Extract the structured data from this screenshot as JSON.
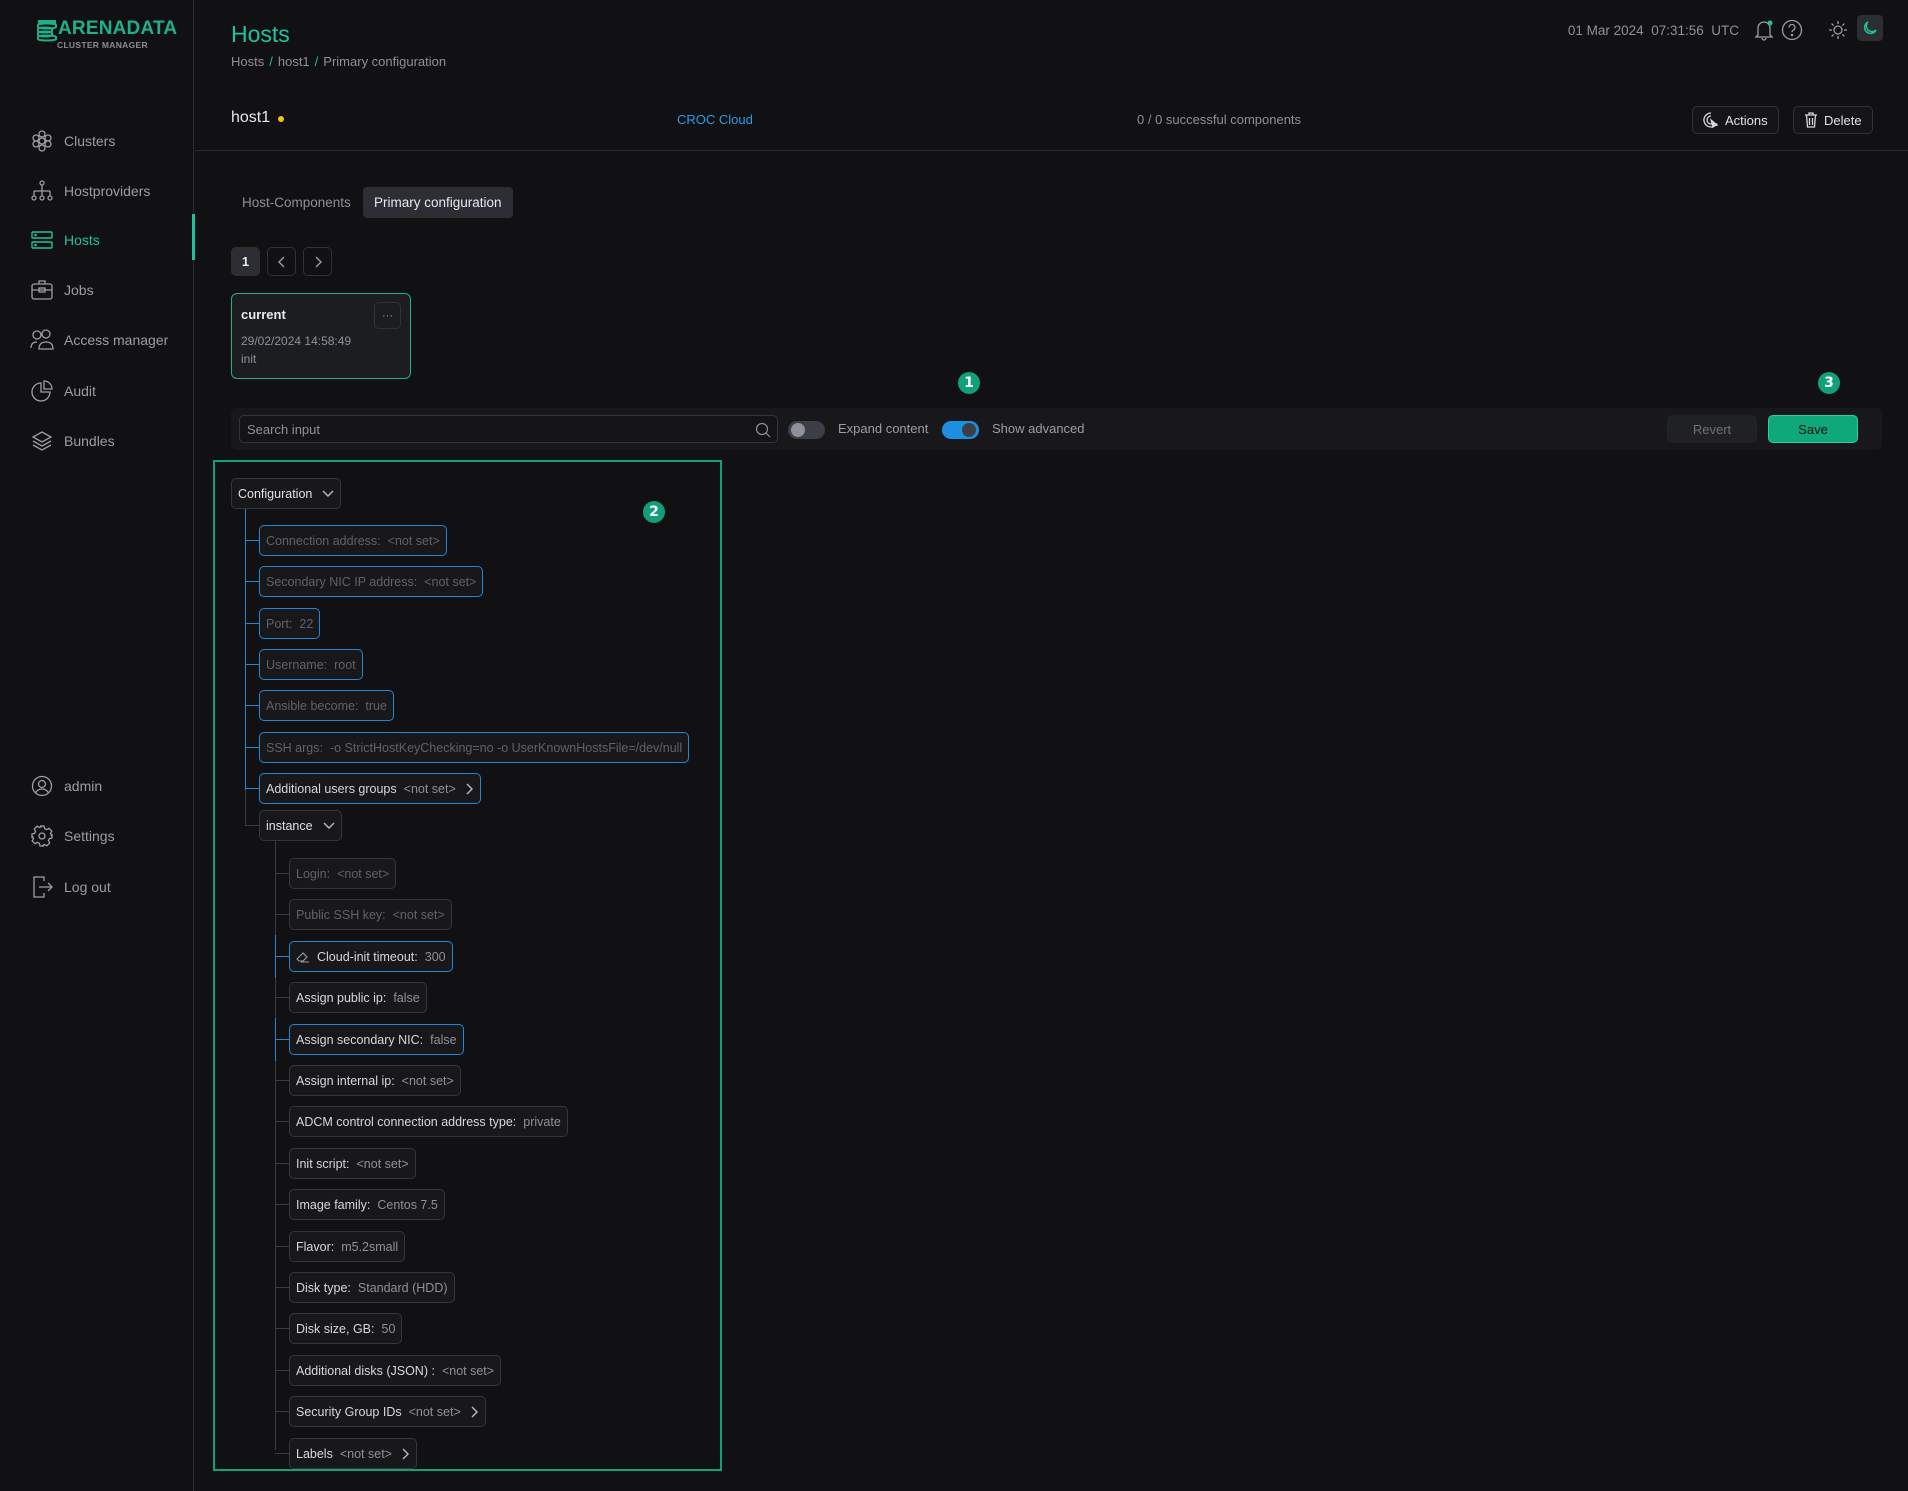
{
  "app": {
    "logo_main": "ARENADATA",
    "logo_sub": "CLUSTER MANAGER",
    "accent_color": "#1fc29a"
  },
  "sidebar": {
    "items": [
      {
        "label": "Clusters",
        "icon": "clusters-icon"
      },
      {
        "label": "Hostproviders",
        "icon": "hostproviders-icon"
      },
      {
        "label": "Hosts",
        "icon": "hosts-icon",
        "active": true
      },
      {
        "label": "Jobs",
        "icon": "jobs-icon"
      },
      {
        "label": "Access manager",
        "icon": "access-manager-icon"
      },
      {
        "label": "Audit",
        "icon": "audit-icon"
      },
      {
        "label": "Bundles",
        "icon": "bundles-icon"
      }
    ],
    "bottom_items": [
      {
        "label": "admin",
        "icon": "user-icon"
      },
      {
        "label": "Settings",
        "icon": "gear-icon"
      },
      {
        "label": "Log out",
        "icon": "logout-icon"
      }
    ]
  },
  "header": {
    "title": "Hosts",
    "breadcrumb": [
      "Hosts",
      "host1",
      "Primary configuration"
    ],
    "breadcrumb_sep": "/",
    "datetime": "01 Mar 2024  07:31:56  UTC"
  },
  "host": {
    "name": "host1",
    "status_color": "#f0c419",
    "provider": "CROC Cloud",
    "components": "0 / 0 successful components",
    "actions_label": "Actions",
    "delete_label": "Delete"
  },
  "tabs": [
    {
      "label": "Host-Components",
      "active": false
    },
    {
      "label": "Primary configuration",
      "active": true
    }
  ],
  "pagination": {
    "current": "1"
  },
  "config_version": {
    "title": "current",
    "date": "29/02/2024 14:58:49",
    "description": "init",
    "menu": "···"
  },
  "badges": {
    "one": "1",
    "two": "2",
    "three": "3"
  },
  "toolbar": {
    "search_placeholder": "Search input",
    "expand_content_label": "Expand content",
    "expand_content_on": false,
    "show_advanced_label": "Show advanced",
    "show_advanced_on": true,
    "revert_label": "Revert",
    "save_label": "Save"
  },
  "tree": {
    "root": "Configuration",
    "fields": [
      {
        "key": "Connection address:",
        "value": "<not set>"
      },
      {
        "key": "Secondary NIC IP address:",
        "value": "<not set>"
      },
      {
        "key": "Port:",
        "value": "22"
      },
      {
        "key": "Username:",
        "value": "root"
      },
      {
        "key": "Ansible become:",
        "value": "true"
      },
      {
        "key": "SSH args:",
        "value": "-o StrictHostKeyChecking=no -o UserKnownHostsFile=/dev/null"
      },
      {
        "key": "Additional users groups",
        "value": "<not set>"
      }
    ],
    "instance_group": "instance",
    "instance_fields": [
      {
        "key": "Login:",
        "value": "<not set>"
      },
      {
        "key": "Public SSH key:",
        "value": "<not set>"
      },
      {
        "key": "Cloud-init timeout:",
        "value": "300"
      },
      {
        "key": "Assign public ip:",
        "value": "false"
      },
      {
        "key": "Assign secondary NIC:",
        "value": "false"
      },
      {
        "key": "Assign internal ip:",
        "value": "<not set>"
      },
      {
        "key": "ADCM control connection address type:",
        "value": "private"
      },
      {
        "key": "Init script:",
        "value": "<not set>"
      },
      {
        "key": "Image family:",
        "value": "Centos 7.5"
      },
      {
        "key": "Flavor:",
        "value": "m5.2small"
      },
      {
        "key": "Disk type:",
        "value": "Standard (HDD)"
      },
      {
        "key": "Disk size, GB:",
        "value": "50"
      },
      {
        "key": "Additional disks (JSON) :",
        "value": "<not set>"
      },
      {
        "key": "Security Group IDs",
        "value": "<not set>"
      },
      {
        "key": "Labels",
        "value": "<not set>"
      }
    ]
  }
}
